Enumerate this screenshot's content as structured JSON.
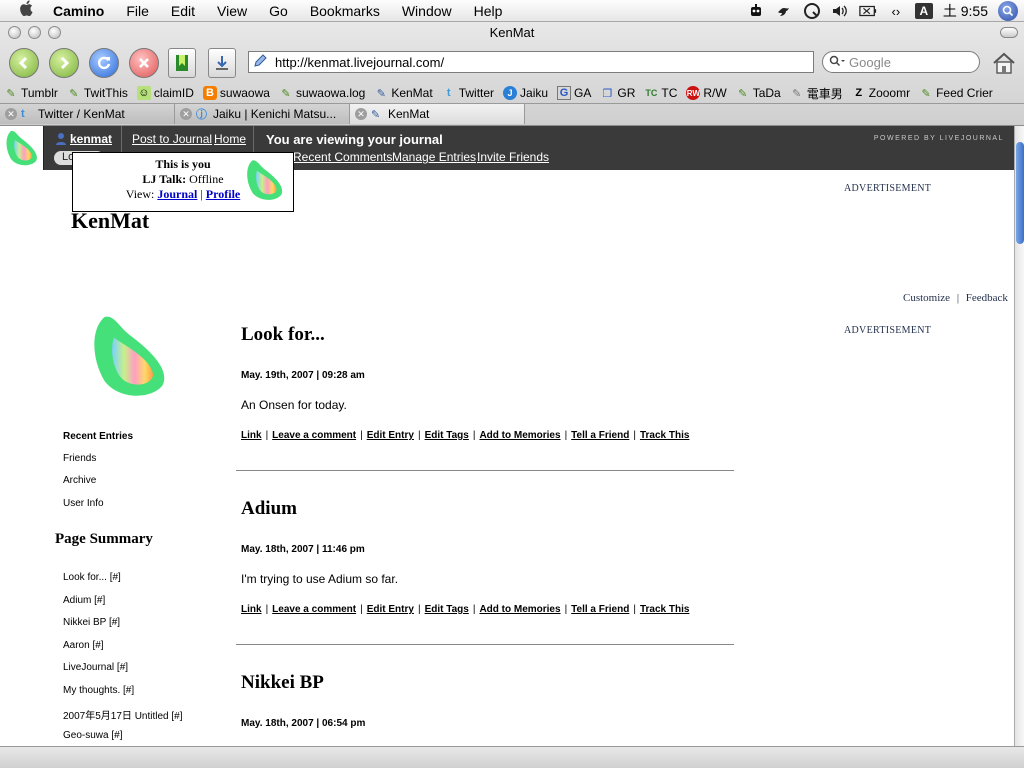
{
  "menubar": {
    "apple": "",
    "items": [
      "Camino",
      "File",
      "Edit",
      "View",
      "Go",
      "Bookmarks",
      "Window",
      "Help"
    ],
    "clock": "土 9:55",
    "input_method": "A"
  },
  "window": {
    "title": "KenMat"
  },
  "toolbar": {
    "url": "http://kenmat.livejournal.com/",
    "search_placeholder": "Google"
  },
  "bookmarks": [
    "Tumblr",
    "TwitThis",
    "claimID",
    "suwaowa",
    "suwaowa.log",
    "KenMat",
    "Twitter",
    "Jaiku",
    "GA",
    "GR",
    "TC",
    "R/W",
    "TaDa",
    "電車男",
    "Zooomr",
    "Feed Crier"
  ],
  "tabs": [
    {
      "label": "Twitter / KenMat"
    },
    {
      "label": "Jaiku | Kenichi Matsu..."
    },
    {
      "label": "KenMat"
    }
  ],
  "ljbar": {
    "username": "kenmat",
    "logout": "Logout",
    "post": "Post to Journal",
    "home": "Home",
    "title": "You are viewing your journal",
    "recent_comments": "Recent Comments",
    "manage_entries": "Manage Entries",
    "invite_friends": "Invite Friends",
    "powered": "POWERED BY LIVEJOURNAL"
  },
  "popup": {
    "line1": "This is you",
    "lj_talk_label": "LJ Talk:",
    "lj_talk_status": "Offline",
    "view_label": "View:",
    "journal": "Journal",
    "sep": "|",
    "profile": "Profile"
  },
  "page": {
    "site_name": "KenMat",
    "advertisement": "ADVERTISEMENT",
    "customize": "Customize",
    "feedback": "Feedback",
    "pipe": "|"
  },
  "sidebar": {
    "recent_entries": "Recent Entries",
    "links": [
      "Friends",
      "Archive",
      "User Info"
    ],
    "page_summary": "Page Summary",
    "summary": [
      "Look for... [#]",
      "Adium [#]",
      "Nikkei BP [#]",
      "Aaron [#]",
      "LiveJournal [#]",
      "My thoughts. [#]",
      "2007年5月17日 Untitled [#]",
      "Geo-suwa [#]"
    ]
  },
  "entries": [
    {
      "title": "Look for...",
      "date": "May. 19th, 2007 | 09:28 am",
      "body": "An Onsen for today."
    },
    {
      "title": "Adium",
      "date": "May. 18th, 2007 | 11:46 pm",
      "body": "I'm trying to use Adium so far."
    },
    {
      "title": "Nikkei BP",
      "date": "May. 18th, 2007 | 06:54 pm",
      "body": ""
    }
  ],
  "entry_links": [
    "Link",
    "Leave a comment",
    "Edit Entry",
    "Edit Tags",
    "Add to Memories",
    "Tell a Friend",
    "Track This"
  ],
  "colors": {
    "lj_bar": "#3a3a3a",
    "link_blue": "#0000cc",
    "ad_text": "#24324e"
  }
}
